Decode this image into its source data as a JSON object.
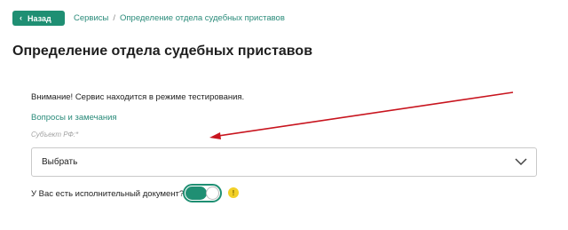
{
  "header": {
    "back_label": "Назад",
    "breadcrumb": {
      "items": [
        "Сервисы",
        "Определение отдела судебных приставов"
      ],
      "separator": "/"
    }
  },
  "main": {
    "title": "Определение отдела судебных приставов",
    "notice": "Внимание! Сервис находится в режиме тестирования.",
    "feedback_link": "Вопросы и замечания",
    "region_field": {
      "label": "Субъект РФ:*",
      "value": "Выбрать"
    },
    "document_question": "У Вас есть исполнительный документ?",
    "toggle_state": "on",
    "help_icon_glyph": "!"
  },
  "colors": {
    "accent": "#1f8f73",
    "link": "#2a8b7a",
    "annotation": "#c8141e",
    "help": "#f2d027"
  }
}
